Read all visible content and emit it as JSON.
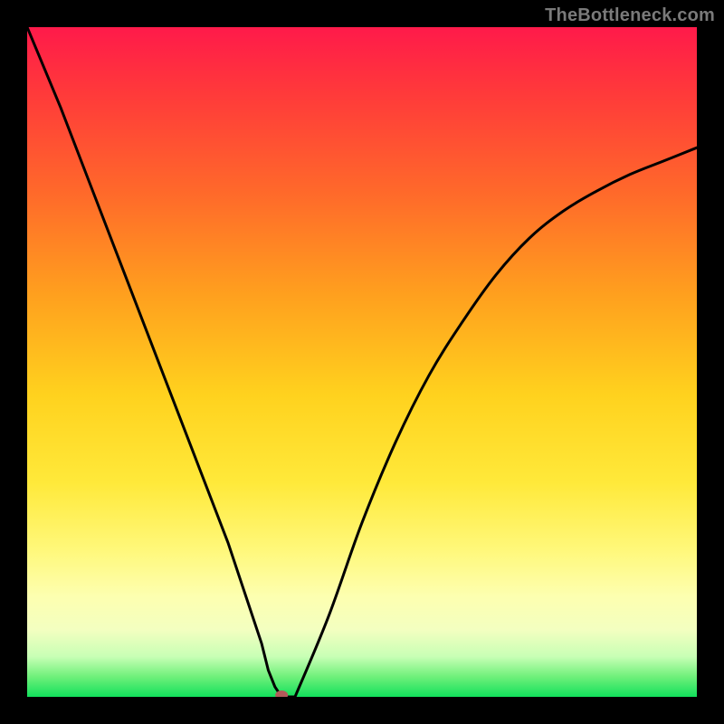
{
  "watermark": "TheBottleneck.com",
  "colors": {
    "gradient_top": "#ff1a4a",
    "gradient_bottom": "#12e05c",
    "curve": "#000000",
    "marker": "#b35a5a",
    "frame": "#000000"
  },
  "chart_data": {
    "type": "line",
    "title": "",
    "xlabel": "",
    "ylabel": "",
    "xlim": [
      0,
      100
    ],
    "ylim": [
      0,
      100
    ],
    "minimum_point": {
      "x": 38,
      "y": 0
    },
    "series": [
      {
        "name": "bottleneck-curve",
        "x": [
          0,
          5,
          10,
          15,
          20,
          25,
          30,
          33,
          35,
          36,
          37,
          38,
          40,
          45,
          50,
          55,
          60,
          65,
          70,
          75,
          80,
          85,
          90,
          95,
          100
        ],
        "y": [
          100,
          88,
          75,
          62,
          49,
          36,
          23,
          14,
          8,
          4,
          1.5,
          0,
          0,
          12,
          26,
          38,
          48,
          56,
          63,
          68.5,
          72.5,
          75.5,
          78,
          80,
          82
        ]
      }
    ],
    "annotations": [
      {
        "type": "marker",
        "x": 38,
        "y": 0,
        "color": "#b35a5a"
      }
    ]
  }
}
